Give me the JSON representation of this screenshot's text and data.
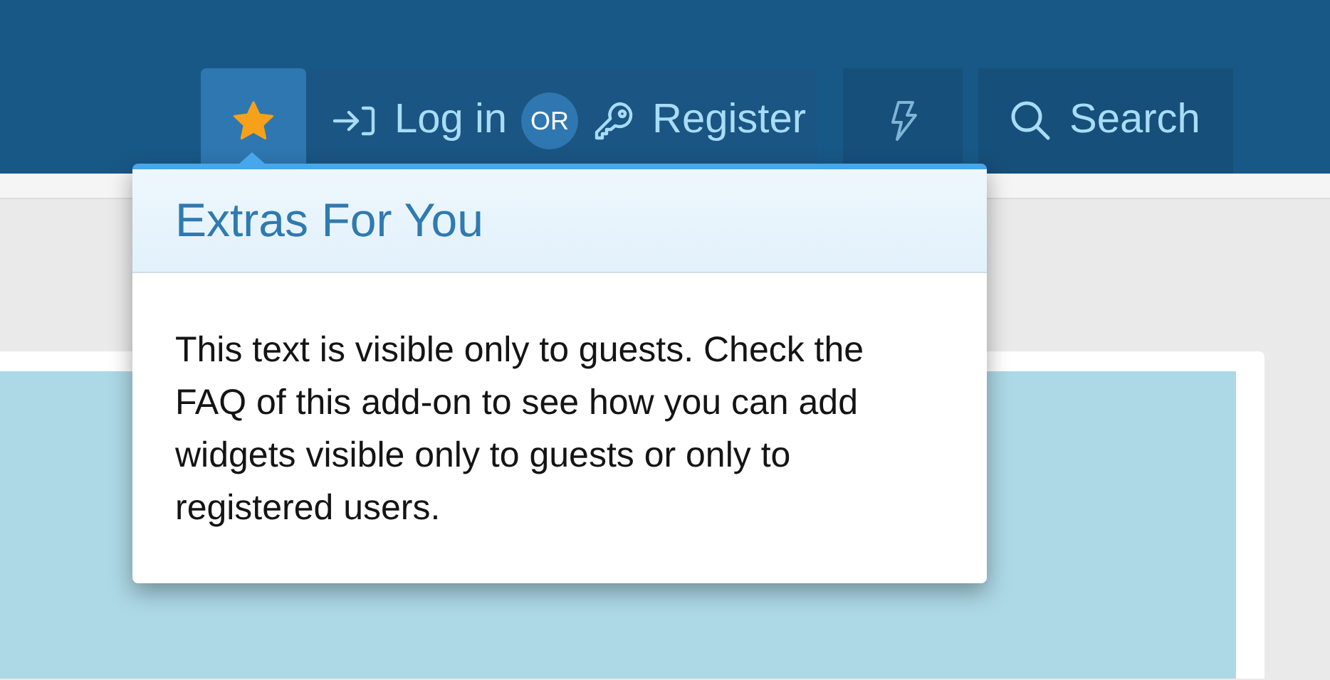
{
  "nav": [
    {
      "kind": "star",
      "selected": true
    },
    {
      "kind": "login",
      "label": "Log in"
    },
    {
      "kind": "or",
      "label": "OR"
    },
    {
      "kind": "register",
      "label": "Register"
    },
    {
      "kind": "bolt",
      "selected": false
    },
    {
      "kind": "search",
      "label": "Search"
    }
  ],
  "popup": {
    "title": "Extras For You",
    "text": "This text is visible only to guests. Check the FAQ of this add-on to see how you can add widgets visible only to guests or only to registered users."
  }
}
